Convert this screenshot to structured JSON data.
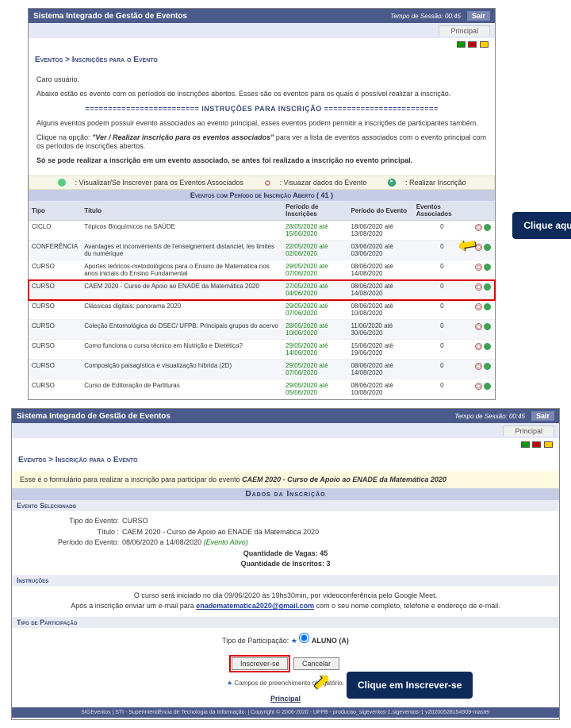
{
  "system_title": "Sistema Integrado de Gestão de Eventos",
  "session_label": "Tempo de Sessão: 00:45",
  "exit_label": "Sair",
  "principal_tab": "Principal",
  "s1": {
    "breadcrumb": "Eventos > Inscrições para o Evento",
    "greeting": "Caro usuário,",
    "intro": "Abaixo estão os evento com os períodos de inscrições abertos. Esses são os eventos para os quais é possível realizar a inscrição.",
    "instr_header": "========================= INSTRUÇÕES PARA INSCRIÇÃO =========================",
    "instr_p1": "Alguns eventos podem possuir evento associados ao evento principal, esses eventos podem permitir a inscrições de participantes também.",
    "instr_p2a": "Clique na opção: ",
    "instr_p2b": "\"Ver / Realizar inscrição para os eventos associados\"",
    "instr_p2c": " para ver a lista de eventos associados com o evento principal com os períodos de inscrições abertos.",
    "instr_p3": "Só se pode realizar a inscrição em um evento associado, se antes foi realizado a inscrição no evento principal.",
    "legend": {
      "assoc": ": Visualizar/Se Inscrever para os Eventos Associados",
      "view": ": Visuazar dados do Evento",
      "reg": ": Realizar Inscrição"
    },
    "table_title": "Eventos com Período de Inscrição Aberto ( 41 )",
    "cols": {
      "tipo": "Tipo",
      "titulo": "Título",
      "periodo_insc": "Período de Inscrições",
      "periodo_ev": "Período do Evento",
      "assoc": "Eventos Associados"
    },
    "rows": [
      {
        "tipo": "CICLO",
        "titulo": "Tópicos Bioquímicos na SAÚDE",
        "insc": "28/05/2020 até 15/06/2020",
        "ev": "18/06/2020 até 13/08/2020",
        "assoc": "0"
      },
      {
        "tipo": "CONFERÊNCIA",
        "titulo": "Avantages et inconvénients de l'enseignement distanciel, les limites du numérique",
        "insc": "22/05/2020 até 02/06/2020",
        "ev": "03/06/2020 até 03/06/2020",
        "assoc": "0"
      },
      {
        "tipo": "CURSO",
        "titulo": "Aportes teóricos-metodológicos para o Ensino de Matemática nos anos iniciais do Ensino Fundamental",
        "insc": "29/05/2020 até 07/06/2020",
        "ev": "08/06/2020 até 14/08/2020",
        "assoc": "0"
      },
      {
        "tipo": "CURSO",
        "titulo": "CAEM 2020 - Curso de Apoio ao ENADE da Matemática 2020",
        "insc": "27/05/2020 até 04/06/2020",
        "ev": "08/06/2020 até 14/08/2020",
        "assoc": "0",
        "hl": true
      },
      {
        "tipo": "CURSO",
        "titulo": "Clássicas digitais: panorama 2020",
        "insc": "29/05/2020 até 07/06/2020",
        "ev": "08/06/2020 até 10/08/2020",
        "assoc": "0"
      },
      {
        "tipo": "CURSO",
        "titulo": "Coleção Entomológica do DSEC/ UFPB: Principais grupos do acervo",
        "insc": "28/05/2020 até 10/06/2020",
        "ev": "11/06/2020 até 30/06/2020",
        "assoc": "0"
      },
      {
        "tipo": "CURSO",
        "titulo": "Como funciona o curso técnico em Nutrição e Dietética?",
        "insc": "29/05/2020 até 14/06/2020",
        "ev": "15/06/2020 até 19/06/2020",
        "assoc": "0"
      },
      {
        "tipo": "CURSO",
        "titulo": "Composição paisagística e visualização híbrida (2D)",
        "insc": "29/05/2020 até 07/06/2020",
        "ev": "08/06/2020 até 14/08/2020",
        "assoc": "0"
      },
      {
        "tipo": "CURSO",
        "titulo": "Curso de Editoração de Partituras",
        "insc": "29/05/2020 até 05/06/2020",
        "ev": "08/06/2020 até 10/08/2020",
        "assoc": "0"
      }
    ]
  },
  "callout1": "Clique aqui",
  "s2": {
    "breadcrumb": "Eventos > Inscrição para o Evento",
    "banner_a": "Esse é o formulário para realizar a inscrição para participar do evento ",
    "banner_b": "CAEM 2020 - Curso de Apoio ao ENADE da Matemática 2020",
    "section_data": "Dados da Inscrição",
    "sub_selected": "Evento Selecionado",
    "tipo_lbl": "Tipo do Evento:",
    "tipo_val": "CURSO",
    "titulo_lbl": "Título :",
    "titulo_val": "CAEM 2020 - Curso de Apoio ao ENADE da Matemática 2020",
    "periodo_lbl": "Período do Evento:",
    "periodo_val": "08/06/2020 a 14/08/2020",
    "periodo_status": "(Evento Ativo)",
    "vagas_lbl": "Quantidade de Vagas:",
    "vagas_val": "45",
    "inscritos_lbl": "Quantidade de Inscritos:",
    "inscritos_val": "3",
    "sub_instr": "Instruções",
    "instr_line1": "O curso será iniciado no dia 09/06/2020 às 19hs30min, por videoconferência pelo Google Meet.",
    "instr_line2a": "Após a inscrição enviar um e-mail para ",
    "instr_email": "enadematematica2020@gmail.com",
    "instr_line2b": " com o seu nome completo, telefone e endereço de e-mail.",
    "sub_tipo": "Tipo de Participação",
    "tp_label": "Tipo de Participação:",
    "tp_option": "ALUNO (A)",
    "btn_inscrever": "Inscrever-se",
    "btn_cancelar": "Cancelar",
    "req_note": "Campos de preenchimento obrigatório.",
    "principal_link": "Principal",
    "copyright": "SIGEventos | STI - Superintendência de Tecnologia da Informação.  | Copyright © 2006-2020 - UFPB - producao_sigeventos-1.sigeventos-1 v20200528154909-master"
  },
  "callout2": "Clique em Inscrever-se"
}
